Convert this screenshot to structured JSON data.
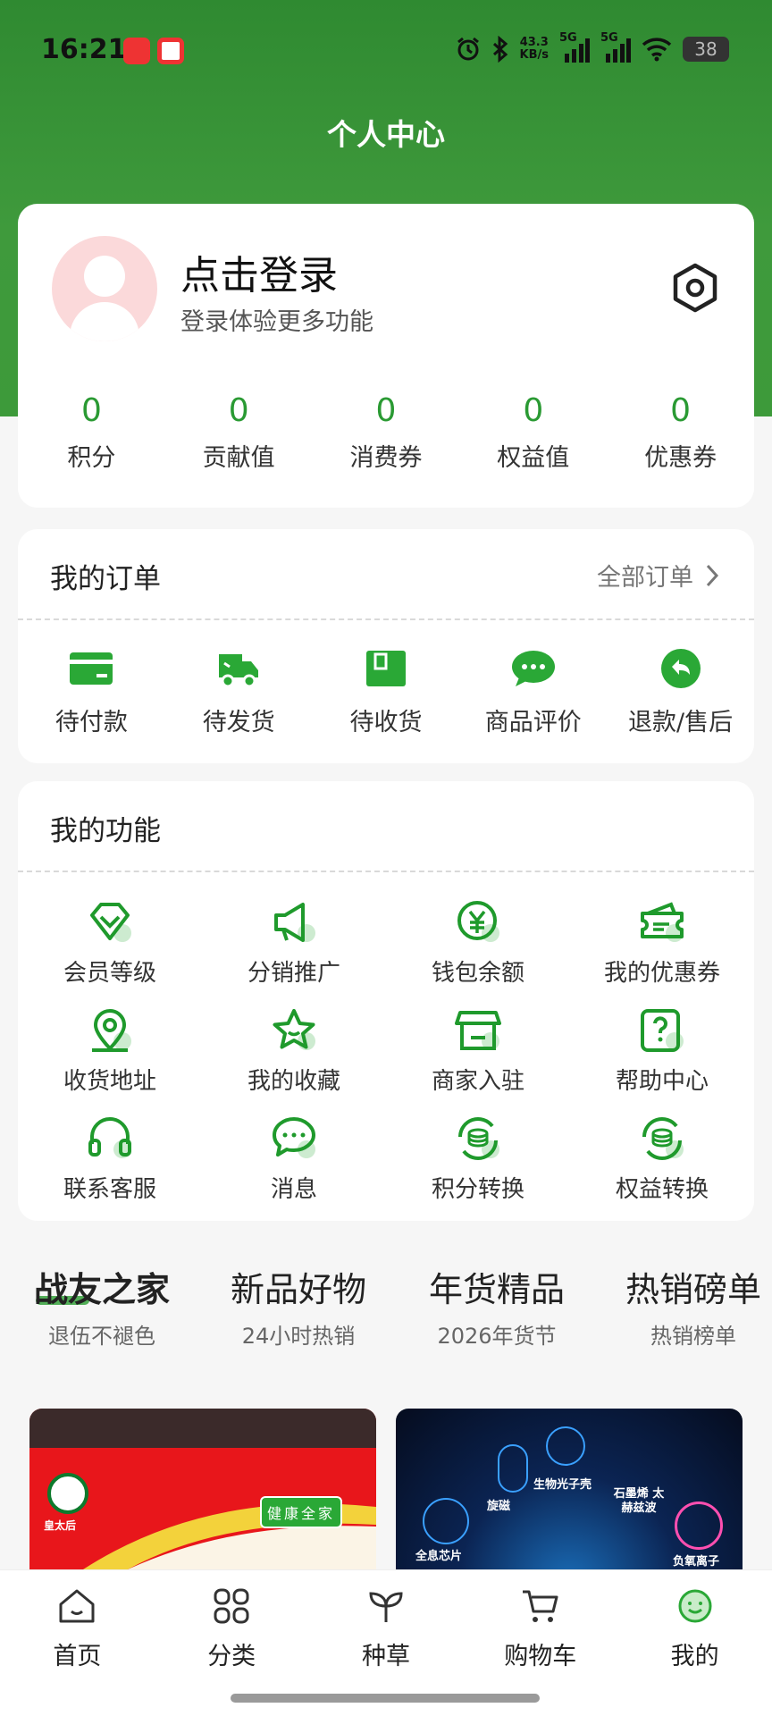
{
  "status_bar": {
    "time": "16:21",
    "network_speed_value": "43.3",
    "network_speed_unit": "KB/s",
    "signal1_label": "5G",
    "signal2_label": "5G",
    "battery": "38",
    "icons": [
      "alarm-icon",
      "bluetooth-icon",
      "signal-icon",
      "wifi-icon",
      "battery-icon"
    ]
  },
  "header": {
    "title": "个人中心"
  },
  "profile": {
    "login_title": "点击登录",
    "login_subtitle": "登录体验更多功能"
  },
  "stats": [
    {
      "value": "0",
      "label": "积分"
    },
    {
      "value": "0",
      "label": "贡献值"
    },
    {
      "value": "0",
      "label": "消费券"
    },
    {
      "value": "0",
      "label": "权益值"
    },
    {
      "value": "0",
      "label": "优惠券"
    }
  ],
  "orders": {
    "title": "我的订单",
    "all_label": "全部订单",
    "items": [
      {
        "label": "待付款",
        "icon": "card-icon"
      },
      {
        "label": "待发货",
        "icon": "truck-icon"
      },
      {
        "label": "待收货",
        "icon": "package-icon"
      },
      {
        "label": "商品评价",
        "icon": "comment-icon"
      },
      {
        "label": "退款/售后",
        "icon": "return-icon"
      }
    ]
  },
  "functions": {
    "title": "我的功能",
    "items": [
      {
        "label": "会员等级",
        "icon": "diamond-icon"
      },
      {
        "label": "分销推广",
        "icon": "megaphone-icon"
      },
      {
        "label": "钱包余额",
        "icon": "yen-icon"
      },
      {
        "label": "我的优惠券",
        "icon": "coupon-icon"
      },
      {
        "label": "收货地址",
        "icon": "location-icon"
      },
      {
        "label": "我的收藏",
        "icon": "star-icon"
      },
      {
        "label": "商家入驻",
        "icon": "store-icon"
      },
      {
        "label": "帮助中心",
        "icon": "help-icon"
      },
      {
        "label": "联系客服",
        "icon": "headset-icon"
      },
      {
        "label": "消息",
        "icon": "message-icon"
      },
      {
        "label": "积分转换",
        "icon": "coin-exchange-icon"
      },
      {
        "label": "权益转换",
        "icon": "coin-exchange-icon"
      }
    ]
  },
  "promo_tabs": [
    {
      "title": "战友之家",
      "subtitle": "退伍不褪色",
      "active": true
    },
    {
      "title": "新品好物",
      "subtitle": "24小时热销",
      "active": false
    },
    {
      "title": "年货精品",
      "subtitle": "2026年货节",
      "active": false
    },
    {
      "title": "热销磅单",
      "subtitle": "热销榜单",
      "active": false
    }
  ],
  "products": [
    {
      "brand_text": "皇太后",
      "tag": "健康全家"
    },
    {
      "labels": [
        "旋磁",
        "生物光子壳",
        "石墨烯 太赫兹波",
        "全息芯片",
        "负氧离子"
      ]
    }
  ],
  "tab_bar": [
    {
      "label": "首页",
      "icon": "home-icon"
    },
    {
      "label": "分类",
      "icon": "grid-icon"
    },
    {
      "label": "种草",
      "icon": "sprout-icon"
    },
    {
      "label": "购物车",
      "icon": "cart-icon"
    },
    {
      "label": "我的",
      "icon": "smile-icon"
    }
  ],
  "colors": {
    "brand_green": "#2a9a33",
    "header_green": "#3d9a3a"
  }
}
